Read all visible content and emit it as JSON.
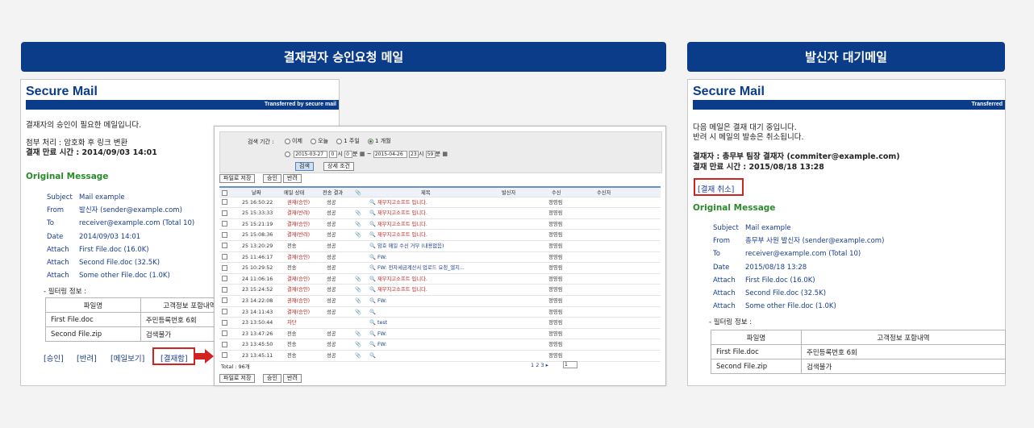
{
  "headers": {
    "left": "결재권자 승인요청 메일",
    "right": "발신자 대기메일"
  },
  "left_mail": {
    "title": "Secure Mail",
    "bar_text": "Transferred by secure mail",
    "intro": "결재자의 승인이 필요한 메일입니다.",
    "attach_process": "첨부 처리 : 암호화 후 링크 변환",
    "deadline": "결재 만료 시간 : 2014/09/03 14:01",
    "original": "Original Message",
    "meta": [
      {
        "k": "Subject",
        "v": "Mail example"
      },
      {
        "k": "From",
        "v": "발신자 (sender@example.com)"
      },
      {
        "k": "To",
        "v": "receiver@example.com (Total 10)"
      },
      {
        "k": "Date",
        "v": "2014/09/03 14:01"
      },
      {
        "k": "Attach",
        "v": "First File.doc (16.0K)"
      },
      {
        "k": "Attach",
        "v": "Second File.doc (32.5K)"
      },
      {
        "k": "Attach",
        "v": "Some other File.doc (1.0K)"
      }
    ],
    "filter_label": "- 필터링 정보 :",
    "filter_head": [
      "파일명",
      "고객정보 포함내역"
    ],
    "filter_rows": [
      [
        "First File.doc",
        "주민등록번호 6회"
      ],
      [
        "Second File.zip",
        "검색불가"
      ]
    ],
    "links": [
      "[승인]",
      "[반려]",
      "[메일보기]",
      "[결재함]"
    ]
  },
  "right_mail": {
    "title": "Secure Mail",
    "bar_text": "Transferred",
    "intro1": "다음 메일은 결재 대기 중입니다.",
    "intro2": "반려 시 메일의 발송은 취소됩니다.",
    "approver": "결재자 : 총무부 팀장 결재자 (commiter@example.com)",
    "deadline": "결재 만료 시간 : 2015/08/18 13:28",
    "cancel": "[결재 취소]",
    "original": "Original Message",
    "meta": [
      {
        "k": "Subject",
        "v": "Mail example"
      },
      {
        "k": "From",
        "v": "총무부 사원 발신자 (sender@example.com)"
      },
      {
        "k": "To",
        "v": "receiver@example.com (Total 10)"
      },
      {
        "k": "Date",
        "v": "2015/08/18 13:28"
      },
      {
        "k": "Attach",
        "v": "First File.doc (16.0K)"
      },
      {
        "k": "Attach",
        "v": "Second File.doc (32.5K)"
      },
      {
        "k": "Attach",
        "v": "Some other File.doc (1.0K)"
      }
    ],
    "filter_label": "- 필터링 정보 :",
    "filter_head": [
      "파일명",
      "고객정보 포함내역"
    ],
    "filter_rows": [
      [
        "First File.doc",
        "주민등록번호 6회"
      ],
      [
        "Second File.zip",
        "검색불가"
      ]
    ]
  },
  "list": {
    "period_label": "검색 기간 :",
    "period_opts": [
      "이제",
      "오늘",
      "1 주일",
      "1 개월"
    ],
    "date_from": "2015-03-27",
    "hour_from": "0",
    "min_from": "0",
    "date_to": "2015-04-26",
    "hour_to": "23",
    "min_to": "59",
    "hour_unit": "시",
    "min_unit": "분",
    "tilde": "~",
    "search_btn": "검색",
    "detail_btn": "상세 조건",
    "actions": [
      "파일로 저장",
      "승인",
      "반려"
    ],
    "cols": [
      "날짜",
      "메일 상태",
      "전송 결과",
      "제목",
      "발신자",
      "수신",
      "수신자"
    ],
    "rows": [
      {
        "d": "25 16:50:22",
        "s": "권재(승인)",
        "r": "성공",
        "a": false,
        "t": "재무지고소프트 입니다.",
        "n": "정영림"
      },
      {
        "d": "25 15:33:33",
        "s": "결재(반려)",
        "r": "성공",
        "a": true,
        "t": "재무지고소프트 입니다.",
        "n": "정영림"
      },
      {
        "d": "25 15:21:19",
        "s": "결재(승인)",
        "r": "성공",
        "a": true,
        "t": "재무지고소프트 입니다.",
        "n": "정영림"
      },
      {
        "d": "25 15:08:36",
        "s": "결재(반려)",
        "r": "성공",
        "a": true,
        "t": "재무지고소프트 입니다.",
        "n": "정영림"
      },
      {
        "d": "25 13:20:29",
        "s": "전송",
        "r": "성공",
        "a": false,
        "t": "암호 메일 수신 거부 (내용없음)",
        "n": "정영림"
      },
      {
        "d": "25 11:46:17",
        "s": "결재(승인)",
        "r": "성공",
        "a": false,
        "t": "FW:",
        "n": "정영림"
      },
      {
        "d": "25 10:29:52",
        "s": "전송",
        "r": "성공",
        "a": false,
        "t": "FW: 전자세금계산서 업로드 요청_엘지...",
        "n": "정영림"
      },
      {
        "d": "24 11:06:16",
        "s": "결재(승인)",
        "r": "성공",
        "a": true,
        "t": "재무지고소프트 입니다.",
        "n": "정영림"
      },
      {
        "d": "23 15:24:52",
        "s": "결재(승인)",
        "r": "성공",
        "a": true,
        "t": "재무지고소프트 입니다.",
        "n": "정영림"
      },
      {
        "d": "23 14:22:08",
        "s": "권재(승인)",
        "r": "성공",
        "a": true,
        "t": "FW:",
        "n": "정영림"
      },
      {
        "d": "23 14:11:43",
        "s": "결재(승인)",
        "r": "성공",
        "a": true,
        "t": "",
        "n": "정영림"
      },
      {
        "d": "23 13:50:44",
        "s": "차단",
        "r": "",
        "a": false,
        "t": "test",
        "n": "정영림"
      },
      {
        "d": "23 13:47:26",
        "s": "전송",
        "r": "성공",
        "a": true,
        "t": "FW:",
        "n": "정영림"
      },
      {
        "d": "23 13:45:50",
        "s": "전송",
        "r": "성공",
        "a": true,
        "t": "FW:",
        "n": "정영림"
      },
      {
        "d": "23 13:45:11",
        "s": "전송",
        "r": "성공",
        "a": true,
        "t": "",
        "n": "정영림"
      }
    ],
    "total": "Total : 96개",
    "pages": "1 2 3 ▸",
    "page_sel": "1"
  },
  "colors": {
    "navy": "#0b3c8a",
    "red": "#d32222",
    "green": "#2a8a2a"
  }
}
